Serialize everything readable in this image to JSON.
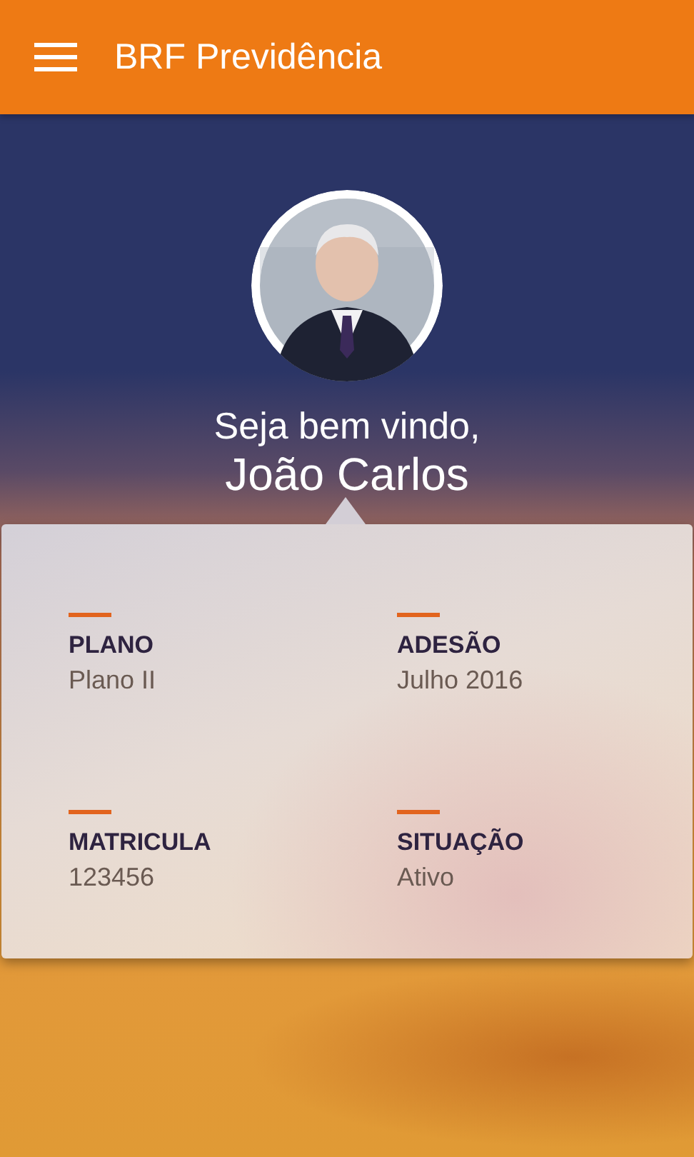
{
  "app_bar": {
    "title": "BRF Previdência"
  },
  "welcome": {
    "greeting": "Seja bem vindo,",
    "name": "João Carlos"
  },
  "info": [
    {
      "label": "PLANO",
      "value": "Plano II"
    },
    {
      "label": "ADESÃO",
      "value": "Julho 2016"
    },
    {
      "label": "MATRICULA",
      "value": "123456"
    },
    {
      "label": "SITUAÇÃO",
      "value": "Ativo"
    }
  ]
}
